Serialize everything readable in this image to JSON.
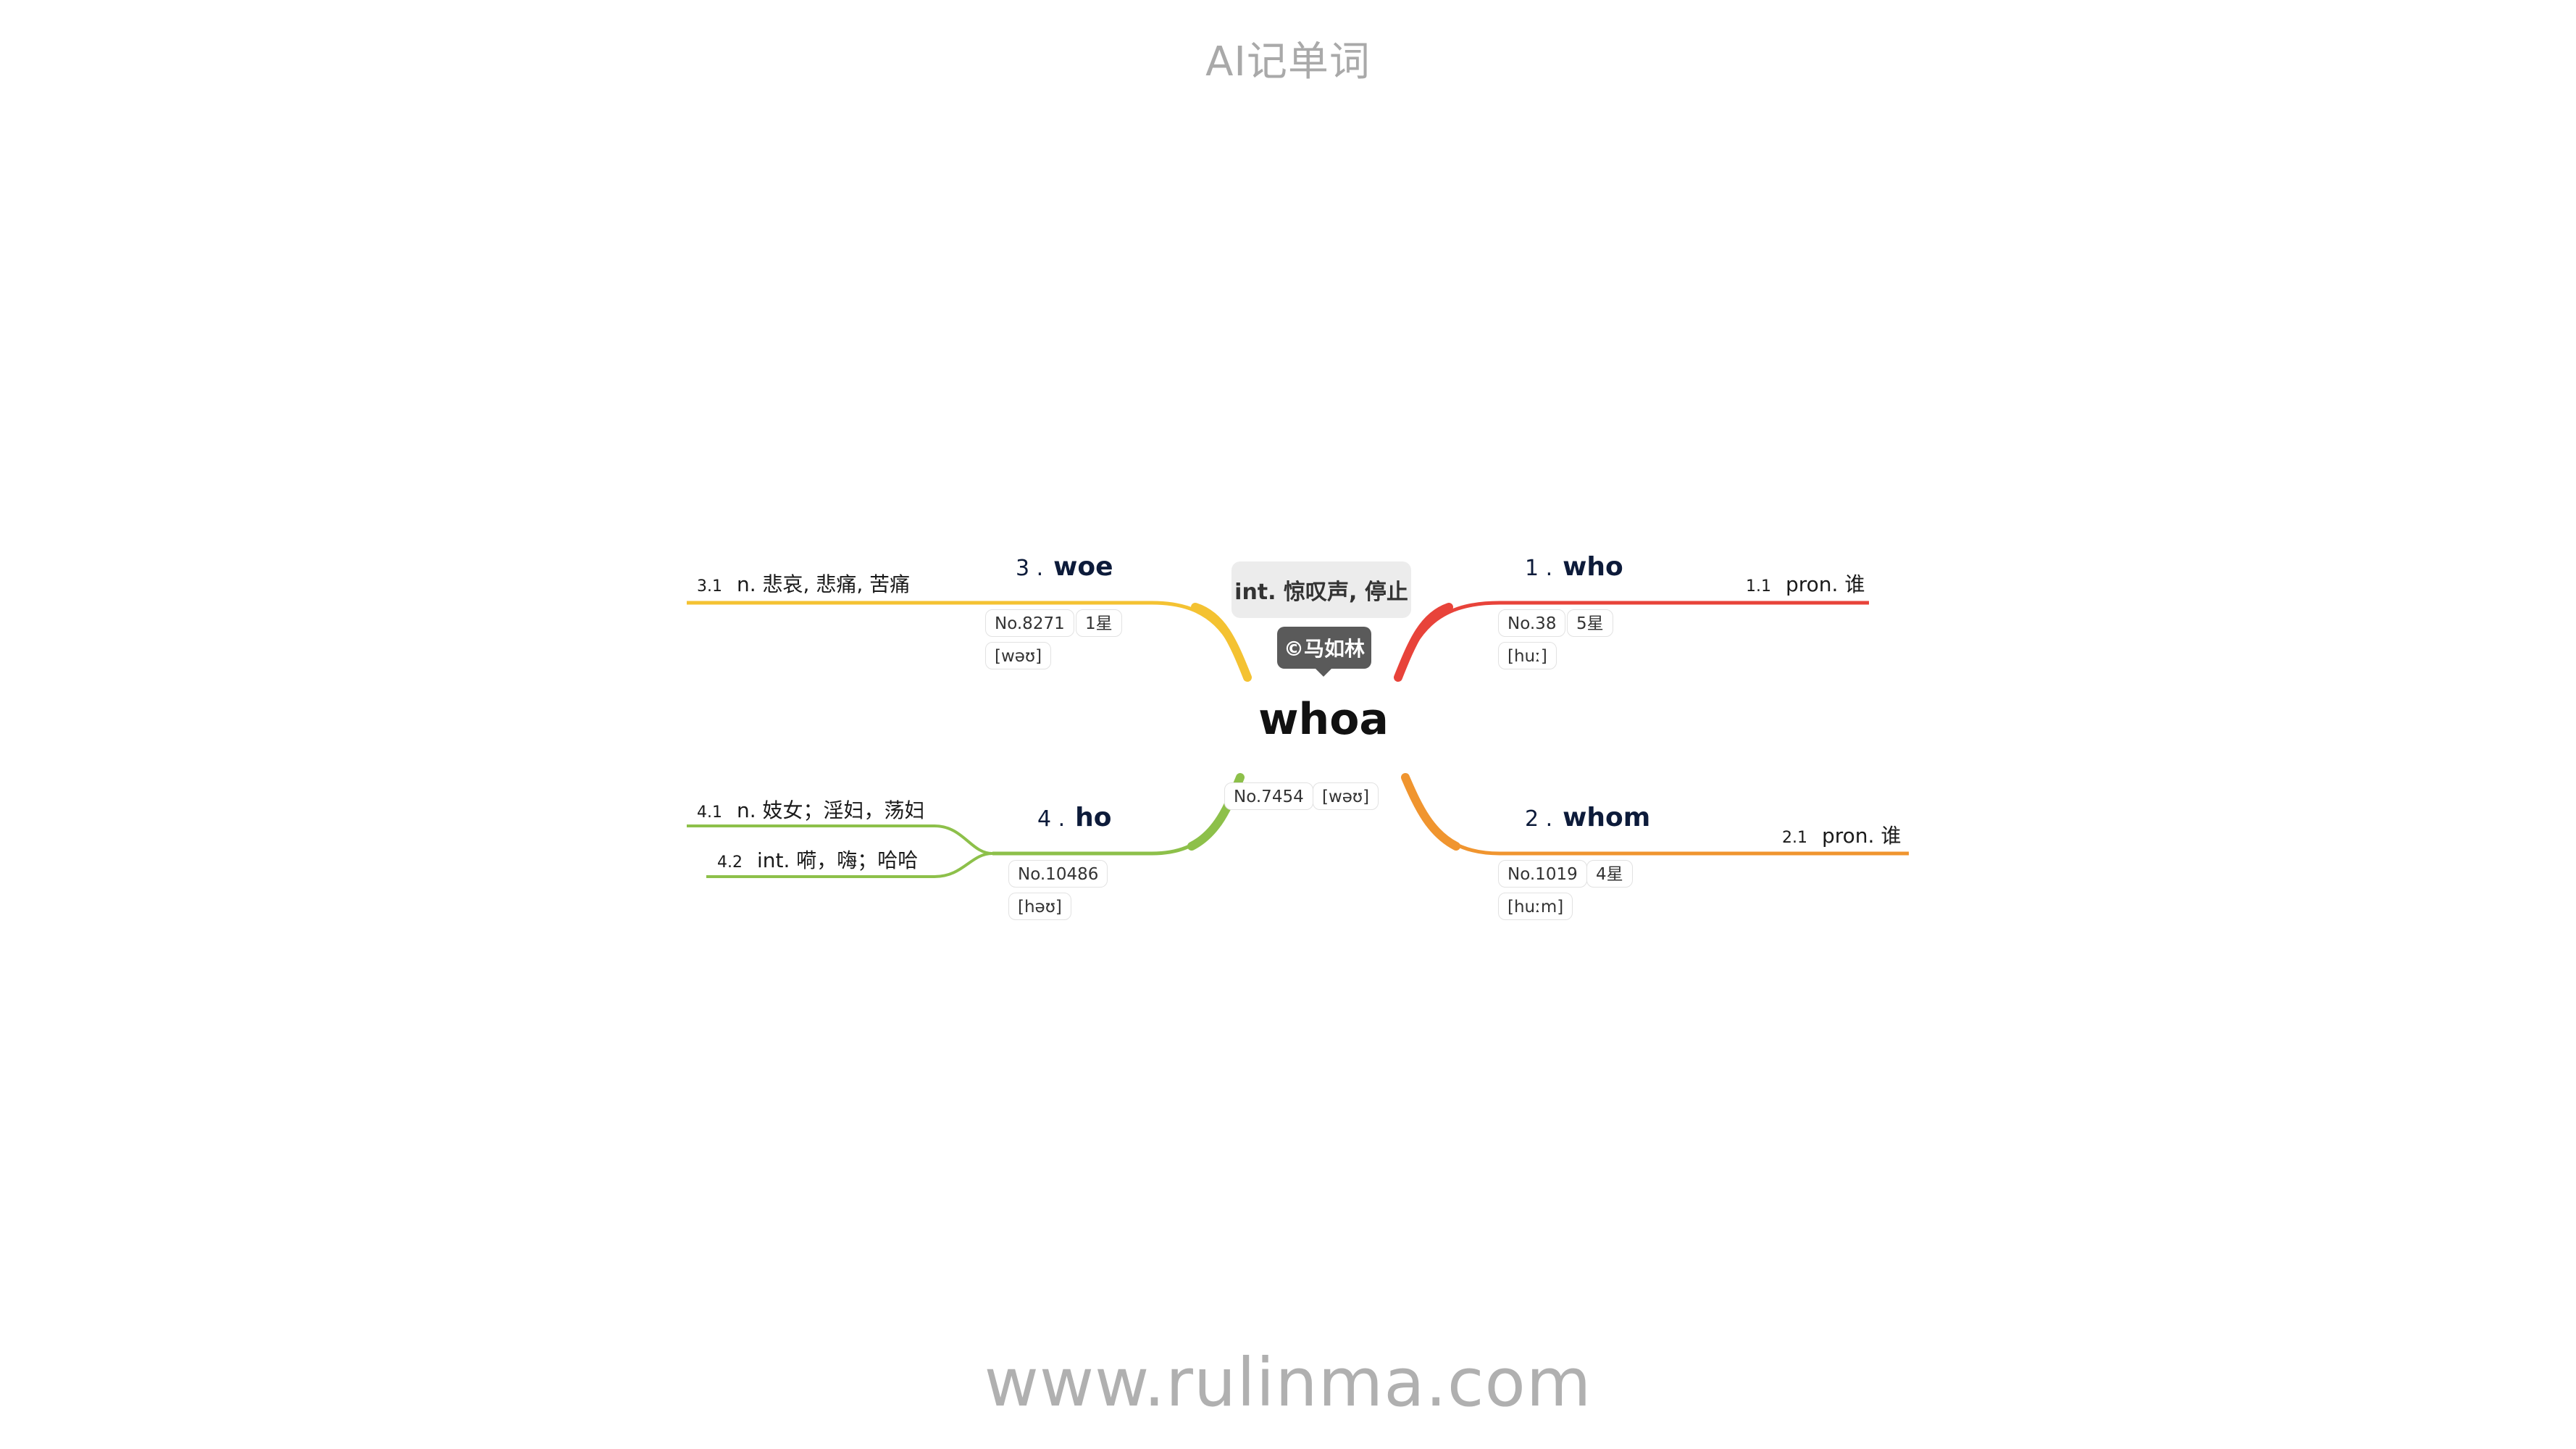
{
  "header": {
    "title": "AI记单词"
  },
  "footer": {
    "site": "www.rulinma.com"
  },
  "colors": {
    "branch1": "#e8433a",
    "branch2": "#f0952f",
    "branch3": "#f4c232",
    "branch4": "#8dc04a"
  },
  "center": {
    "word": "whoa",
    "meaning": "int. 惊叹声, 停止",
    "copyright": "©马如林",
    "rank": "No.7454",
    "phonetic": "[wəʊ]"
  },
  "branches": [
    {
      "num": "1 .",
      "word": "who",
      "rank": "No.38",
      "stars": "5星",
      "phonetic": "[huː]",
      "defs": [
        {
          "idx": "1.1",
          "text": "pron. 谁"
        }
      ]
    },
    {
      "num": "2 .",
      "word": "whom",
      "rank": "No.1019",
      "stars": "4星",
      "phonetic": "[huːm]",
      "defs": [
        {
          "idx": "2.1",
          "text": "pron. 谁"
        }
      ]
    },
    {
      "num": "3 .",
      "word": "woe",
      "rank": "No.8271",
      "stars": "1星",
      "phonetic": "[wəʊ]",
      "defs": [
        {
          "idx": "3.1",
          "text": "n. 悲哀, 悲痛, 苦痛"
        }
      ]
    },
    {
      "num": "4 .",
      "word": "ho",
      "rank": "No.10486",
      "phonetic": "[həʊ]",
      "defs": [
        {
          "idx": "4.1",
          "text": "n. 妓女；淫妇，荡妇"
        },
        {
          "idx": "4.2",
          "text": "int. 嗬，嗨；哈哈"
        }
      ]
    }
  ]
}
